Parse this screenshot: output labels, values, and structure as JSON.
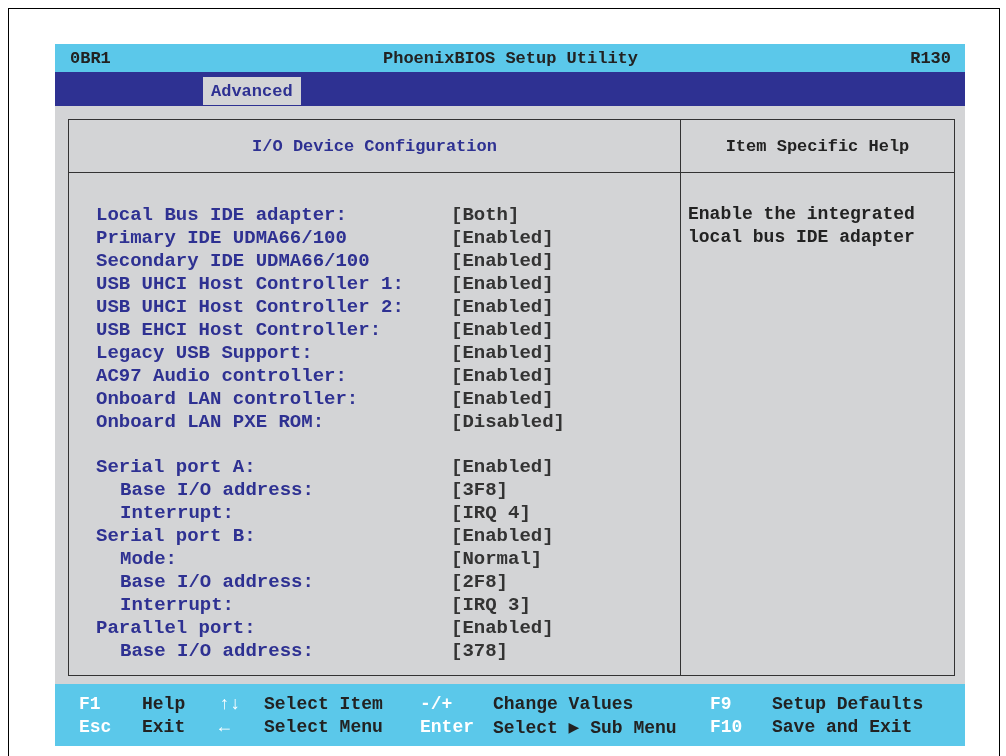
{
  "title_bar": {
    "left": "0BR1",
    "title": "PhoenixBIOS Setup Utility",
    "right": "R130"
  },
  "tabs": [
    {
      "label": "Advanced",
      "selected": true
    }
  ],
  "panel": {
    "title": "I/O Device Configuration",
    "help_title": "Item Specific Help",
    "help_text": "Enable the integrated local bus IDE adapter",
    "groups": [
      {
        "items": [
          {
            "label": "Local Bus IDE adapter:",
            "value": "[Both]"
          },
          {
            "label": "Primary IDE UDMA66/100",
            "value": "[Enabled]"
          },
          {
            "label": "Secondary IDE UDMA66/100",
            "value": "[Enabled]"
          },
          {
            "label": "USB UHCI Host Controller 1:",
            "value": "[Enabled]"
          },
          {
            "label": "USB UHCI Host Controller 2:",
            "value": "[Enabled]"
          },
          {
            "label": "USB EHCI Host Controller:",
            "value": "[Enabled]"
          },
          {
            "label": "Legacy USB Support:",
            "value": "[Enabled]"
          },
          {
            "label": "AC97 Audio controller:",
            "value": "[Enabled]"
          },
          {
            "label": "Onboard LAN controller:",
            "value": "[Enabled]"
          },
          {
            "label": "Onboard LAN PXE ROM:",
            "value": "[Disabled]"
          }
        ]
      },
      {
        "items": [
          {
            "label": "Serial port A:",
            "value": "[Enabled]",
            "children": [
              {
                "label": "Base I/O address:",
                "value": "[3F8]"
              },
              {
                "label": "Interrupt:",
                "value": "[IRQ 4]"
              }
            ]
          },
          {
            "label": "Serial port B:",
            "value": "[Enabled]",
            "children": [
              {
                "label": "Mode:",
                "value": "[Normal]"
              },
              {
                "label": "Base I/O address:",
                "value": "[2F8]"
              },
              {
                "label": "Interrupt:",
                "value": "[IRQ 3]"
              }
            ]
          },
          {
            "label": "Parallel port:",
            "value": "[Enabled]",
            "children": [
              {
                "label": "Base I/O address:",
                "value": "[378]"
              }
            ]
          }
        ]
      }
    ]
  },
  "footer": [
    [
      {
        "key": "F1",
        "label": "Help"
      },
      {
        "key": "↑↓",
        "label": "Select Item"
      },
      {
        "key": "-/+",
        "label": "Change Values"
      },
      {
        "key": "F9",
        "label": "Setup Defaults"
      }
    ],
    [
      {
        "key": "Esc",
        "label": "Exit"
      },
      {
        "key": "←",
        "label": "Select Menu"
      },
      {
        "key": "Enter",
        "label": "Select ▶ Sub Menu"
      },
      {
        "key": "F10",
        "label": "Save and Exit"
      }
    ]
  ]
}
